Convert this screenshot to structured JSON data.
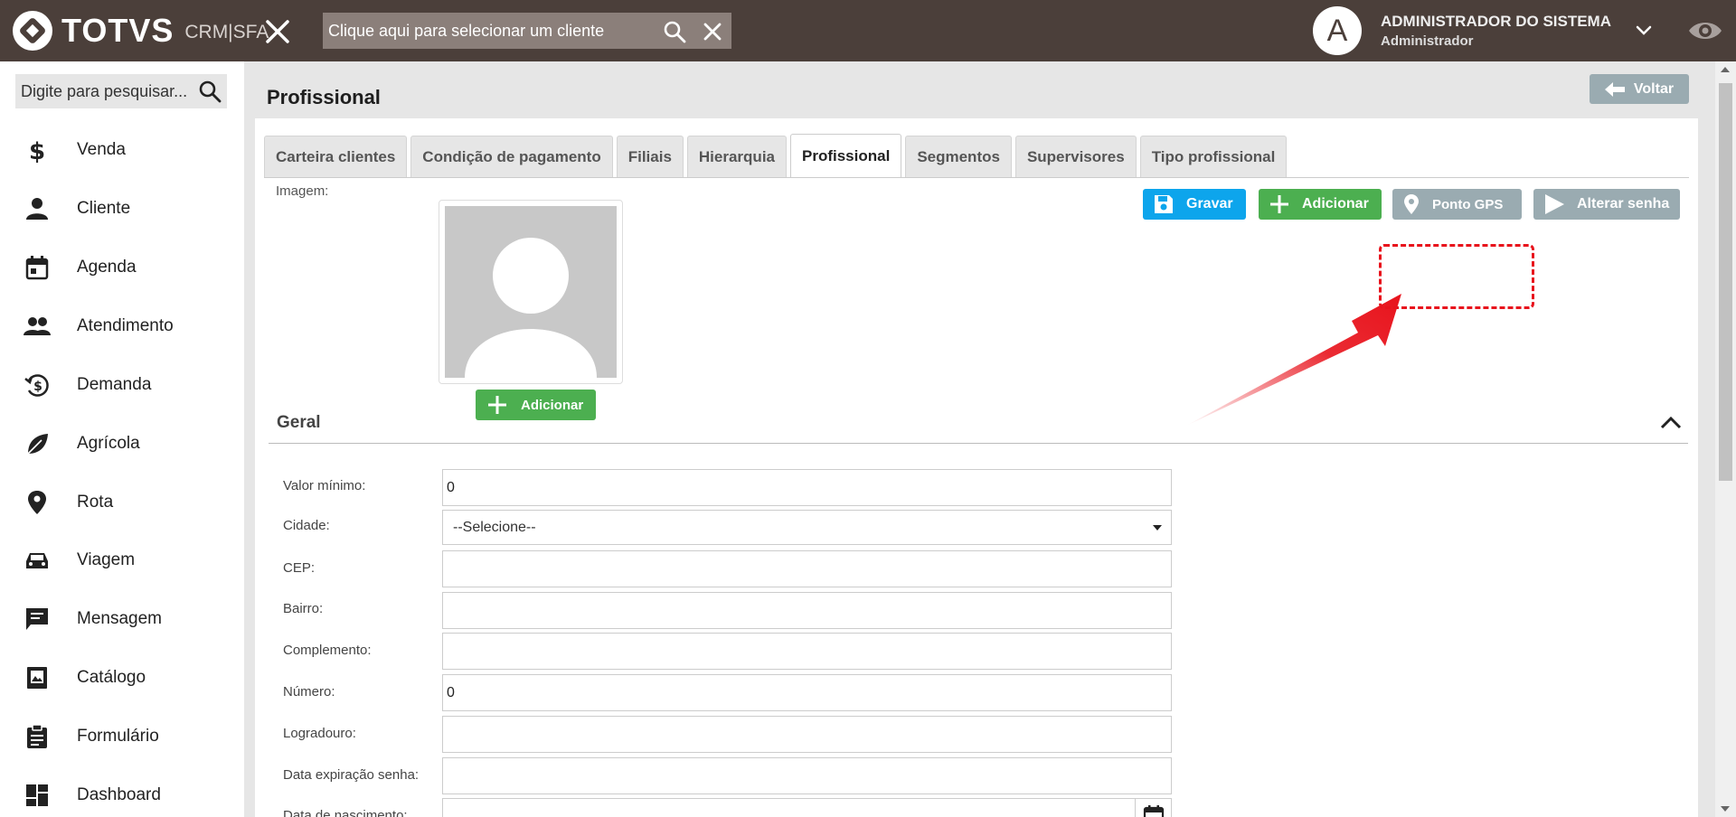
{
  "header": {
    "logo_text": "TOTVS",
    "logo_sub": "CRM|SFA",
    "client_search_placeholder": "Clique aqui para selecionar um cliente",
    "user_initial": "A",
    "user_name": "ADMINISTRADOR DO SISTEMA",
    "user_role": "Administrador"
  },
  "sidebar": {
    "search_placeholder": "Digite para pesquisar...",
    "items": [
      {
        "label": "Venda",
        "icon": "dollar-icon"
      },
      {
        "label": "Cliente",
        "icon": "person-icon"
      },
      {
        "label": "Agenda",
        "icon": "calendar-icon"
      },
      {
        "label": "Atendimento",
        "icon": "people-icon"
      },
      {
        "label": "Demanda",
        "icon": "money-history-icon"
      },
      {
        "label": "Agrícola",
        "icon": "leaf-icon"
      },
      {
        "label": "Rota",
        "icon": "location-pin-icon"
      },
      {
        "label": "Viagem",
        "icon": "car-icon"
      },
      {
        "label": "Mensagem",
        "icon": "message-icon"
      },
      {
        "label": "Catálogo",
        "icon": "photo-book-icon"
      },
      {
        "label": "Formulário",
        "icon": "clipboard-icon"
      },
      {
        "label": "Dashboard",
        "icon": "dashboard-icon"
      }
    ]
  },
  "page": {
    "title": "Profissional",
    "back_label": "Voltar"
  },
  "tabs": [
    {
      "label": "Carteira clientes",
      "active": false
    },
    {
      "label": "Condição de pagamento",
      "active": false
    },
    {
      "label": "Filiais",
      "active": false
    },
    {
      "label": "Hierarquia",
      "active": false
    },
    {
      "label": "Profissional",
      "active": true
    },
    {
      "label": "Segmentos",
      "active": false
    },
    {
      "label": "Supervisores",
      "active": false
    },
    {
      "label": "Tipo profissional",
      "active": false
    }
  ],
  "image": {
    "label": "Imagem:",
    "add_label": "Adicionar"
  },
  "actions": {
    "save_label": "Gravar",
    "add_label": "Adicionar",
    "gps_label": "Ponto GPS",
    "password_label": "Alterar senha"
  },
  "section": {
    "title": "Geral"
  },
  "fields": [
    {
      "label": "Valor mínimo:",
      "value": "0",
      "type": "text"
    },
    {
      "label": "Cidade:",
      "value": "--Selecione--",
      "type": "select"
    },
    {
      "label": "CEP:",
      "value": "",
      "type": "text"
    },
    {
      "label": "Bairro:",
      "value": "",
      "type": "text"
    },
    {
      "label": "Complemento:",
      "value": "",
      "type": "text"
    },
    {
      "label": "Número:",
      "value": "0",
      "type": "text"
    },
    {
      "label": "Logradouro:",
      "value": "",
      "type": "text"
    },
    {
      "label": "Data expiração senha:",
      "value": "",
      "type": "text"
    },
    {
      "label": "Data de nascimento:",
      "value": "",
      "type": "date"
    }
  ],
  "colors": {
    "topbar": "#4b3f3a",
    "green": "#4caf50",
    "blue": "#0da5ec",
    "gray_button": "#9aabb1",
    "highlight": "#e8131c"
  }
}
